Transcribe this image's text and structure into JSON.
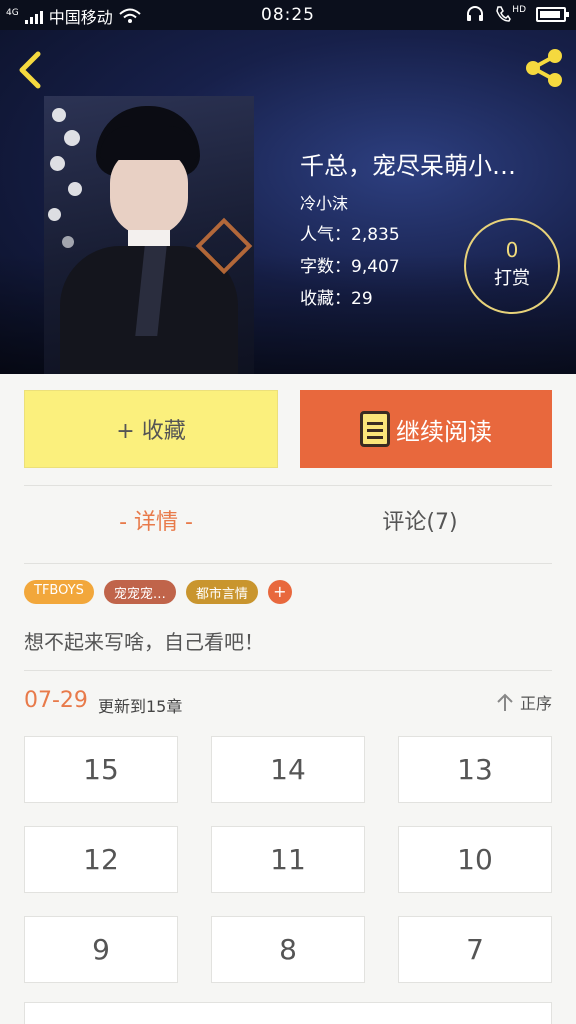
{
  "status_bar": {
    "network": "4G",
    "carrier": "中国移动",
    "time": "08:25",
    "hd_label": "HD"
  },
  "book": {
    "title": "千总，宠尽呆萌小…",
    "author": "冷小沫",
    "stats": [
      {
        "label": "人气：",
        "value": "2,835"
      },
      {
        "label": "字数：",
        "value": "9,407"
      },
      {
        "label": "收藏：",
        "value": "29"
      }
    ],
    "tip": {
      "count": "0",
      "label": "打赏"
    }
  },
  "actions": {
    "favorite_label": "+ 收藏",
    "read_label": "继续阅读"
  },
  "tabs": {
    "detail": "- 详情 -",
    "comment": "评论(7)"
  },
  "tags": [
    {
      "label": "TFBOYS",
      "color": "#f2a73b"
    },
    {
      "label": "宠宠宠…",
      "color": "#c0644a"
    },
    {
      "label": "都市言情",
      "color": "#c9952e"
    }
  ],
  "tag_more": "+",
  "description": "想不起来写啥，自己看吧！",
  "update": {
    "date": "07-29",
    "text": "更新到15章",
    "sort_label": "正序"
  },
  "chapters": [
    "15",
    "14",
    "13",
    "12",
    "11",
    "10",
    "9",
    "8",
    "7"
  ],
  "colors": {
    "accent_orange": "#e8683d",
    "favorite_yellow": "#fbf07d",
    "share_yellow": "#f5d93f"
  }
}
